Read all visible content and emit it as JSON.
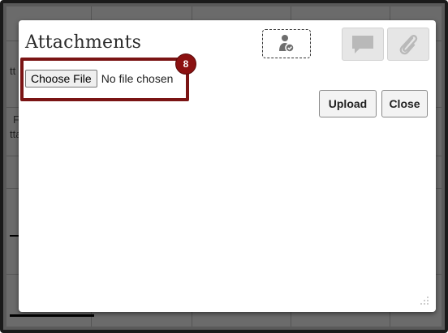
{
  "dialog": {
    "title": "Attachments",
    "file_input": {
      "button_label": "Choose File",
      "status_text": "No file chosen"
    },
    "step_badge": "8",
    "actions": {
      "upload_label": "Upload",
      "close_label": "Close"
    },
    "toolbar_icons": [
      "user-status-icon",
      "comment-icon",
      "paperclip-icon"
    ]
  },
  "background": {
    "fragments": [
      "tt",
      "F",
      "tta"
    ]
  },
  "colors": {
    "highlight": "#7a1414",
    "badge": "#8b1111",
    "overlay": "#6b6b6b"
  }
}
